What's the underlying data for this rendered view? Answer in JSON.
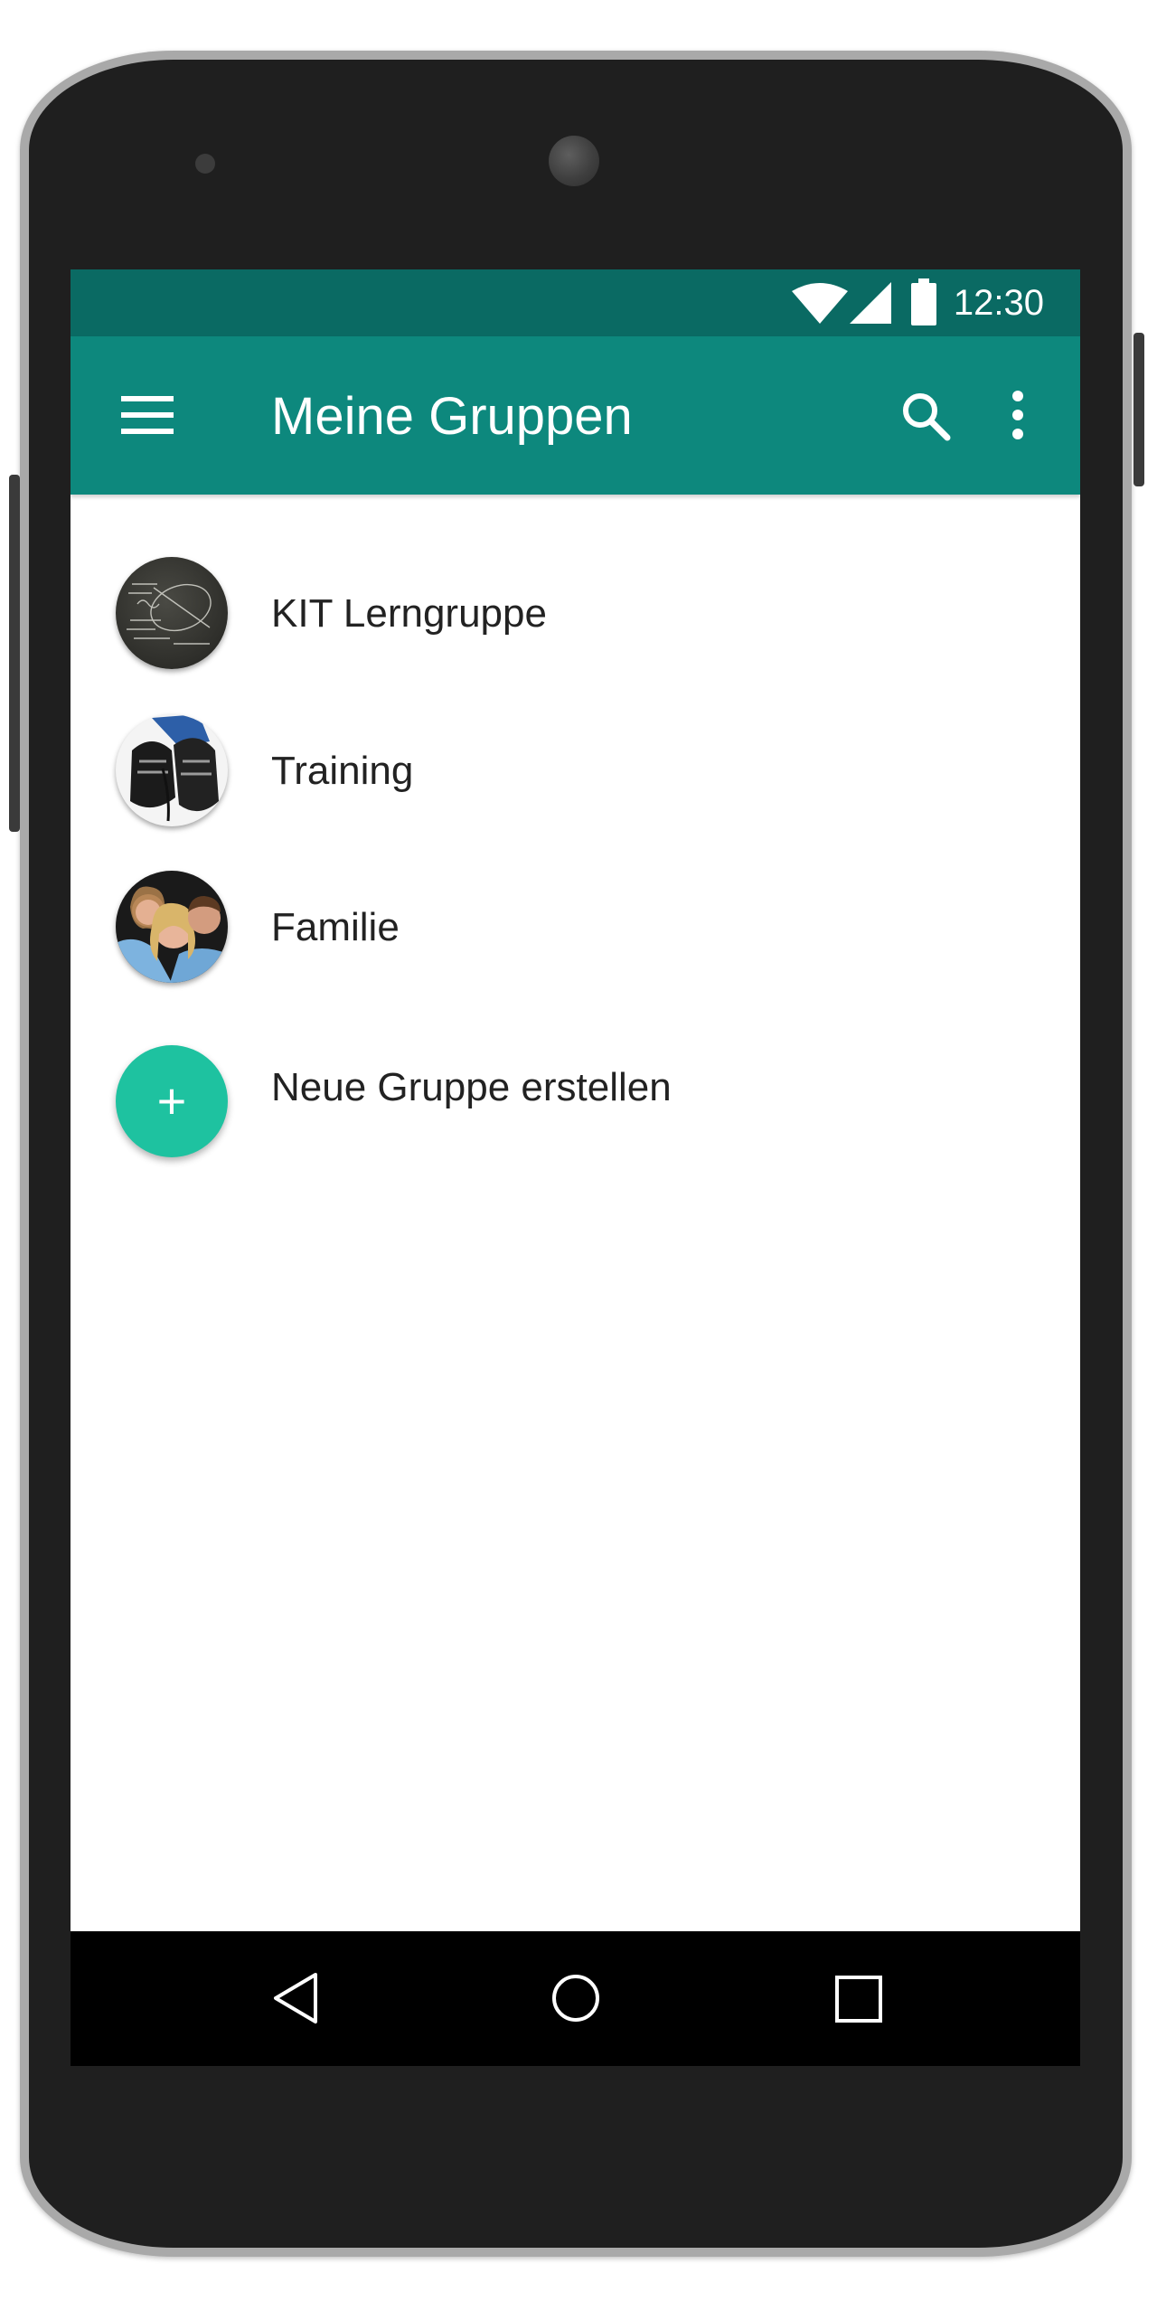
{
  "status_bar": {
    "time": "12:30",
    "icons": [
      "wifi-icon",
      "cellular-signal-icon",
      "battery-icon"
    ]
  },
  "app_bar": {
    "title": "Meine Gruppen",
    "icons": [
      "menu-icon",
      "search-icon",
      "more-vert-icon"
    ]
  },
  "groups": [
    {
      "name": "KIT Lerngruppe",
      "avatar": "chalkboard-formulas-photo"
    },
    {
      "name": "Training",
      "avatar": "running-shoes-photo"
    },
    {
      "name": "Familie",
      "avatar": "family-photo"
    }
  ],
  "create_group": {
    "label": "Neue Gruppe erstellen",
    "icon": "+"
  },
  "navigation": {
    "icons": [
      "back-icon",
      "home-icon",
      "recents-icon"
    ]
  },
  "colors": {
    "status_bar": "#0a6a63",
    "app_bar": "#0d887d",
    "fab": "#1ec2a0",
    "nav_bar": "#000000",
    "phone_body": "#1f1f1f"
  }
}
